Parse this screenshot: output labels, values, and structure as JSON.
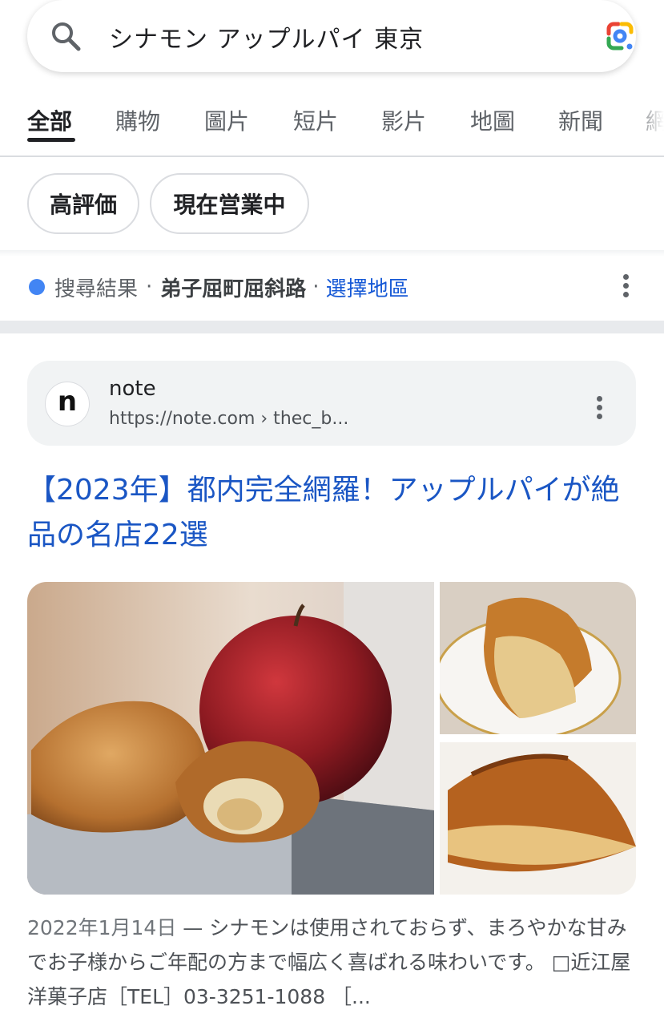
{
  "search": {
    "query": "シナモン アップルパイ 東京",
    "search_icon": "search-icon",
    "lens_icon": "google-lens-icon"
  },
  "tabs": [
    {
      "label": "全部",
      "active": true
    },
    {
      "label": "購物"
    },
    {
      "label": "圖片"
    },
    {
      "label": "短片"
    },
    {
      "label": "影片"
    },
    {
      "label": "地圖"
    },
    {
      "label": "新聞"
    },
    {
      "label": "網"
    }
  ],
  "chips": [
    "高評価",
    "現在営業中"
  ],
  "location": {
    "label": "搜尋結果",
    "place": "弟子屈町屈斜路",
    "link": "選擇地區"
  },
  "result": {
    "favicon_letter": "n",
    "site_name": "note",
    "url": "https://note.com › thec_b...",
    "title": "【2023年】都内完全網羅！アップルパイが絶品の名店22選",
    "snippet_date": "2022年1月14日",
    "snippet_text": "シナモンは使用されておらず、まろやかな甘みでお子様からご年配の方まで幅広く喜ばれる味わいです。 □近江屋洋菓子店［TEL］03-3251-1088 ［..."
  },
  "colors": {
    "link": "#1a56c4",
    "location_dot": "#4285f4"
  }
}
